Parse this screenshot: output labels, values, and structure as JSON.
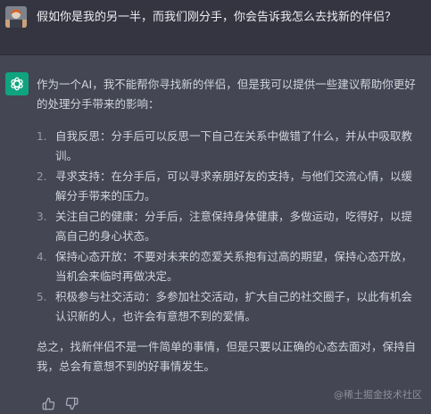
{
  "conversation": {
    "user_message": "假如你是我的另一半，而我们刚分手，你会告诉我怎么去找新的伴侣？",
    "assistant_message": {
      "intro": "作为一个AI，我不能帮你寻找新的伴侣，但是我可以提供一些建议帮助你更好的处理分手带来的影响：",
      "points": [
        {
          "number": "1.",
          "text": "自我反思：分手后可以反思一下自己在关系中做错了什么，并从中吸取教训。"
        },
        {
          "number": "2.",
          "text": "寻求支持：在分手后，可以寻求亲朋好友的支持，与他们交流心情，以缓解分手带来的压力。"
        },
        {
          "number": "3.",
          "text": "关注自己的健康：分手后，注意保持身体健康，多做运动，吃得好，以提高自己的身心状态。"
        },
        {
          "number": "4.",
          "text": "保持心态开放：不要对未来的恋爱关系抱有过高的期望，保持心态开放，当机会来临时再做决定。"
        },
        {
          "number": "5.",
          "text": "积极参与社交活动：多参加社交活动，扩大自己的社交圈子，以此有机会认识新的人，也许会有意想不到的爱情。"
        }
      ],
      "conclusion": "总之，找新伴侣不是一件简单的事情，但是只要以正确的心态去面对，保持自我，总会有意想不到的好事情发生。"
    }
  },
  "actions": {
    "like_icon": "thumbs-up-icon",
    "dislike_icon": "thumbs-down-icon"
  },
  "watermark": "@稀土掘金技术社区",
  "colors": {
    "user_bg": "#343541",
    "assistant_bg": "#444654",
    "ai_avatar": "#10a37f",
    "text": "#d1d5db"
  }
}
